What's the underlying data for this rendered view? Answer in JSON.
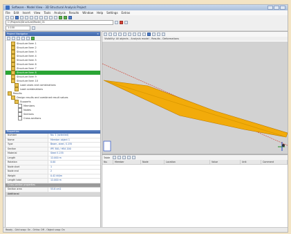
{
  "window": {
    "title": "Software - Model View - 3D Structural Analysis Project"
  },
  "menu": [
    "File",
    "Edit",
    "Insert",
    "View",
    "Tools",
    "Analysis",
    "Results",
    "Window",
    "Help",
    "Settings",
    "Extras"
  ],
  "toolbar": {
    "address": "C:\\Projects\\Structure\\Model_01",
    "filter": "1:100"
  },
  "navigator": {
    "header": "Project Navigator",
    "items": [
      {
        "label": "Structure Item 1",
        "level": 1,
        "selected": false
      },
      {
        "label": "Structure Item 2",
        "level": 1,
        "selected": false
      },
      {
        "label": "Structure Item 3",
        "level": 1,
        "selected": false
      },
      {
        "label": "Structure Item 4",
        "level": 1,
        "selected": false
      },
      {
        "label": "Structure Item 5",
        "level": 1,
        "selected": false
      },
      {
        "label": "Structure Item 6",
        "level": 1,
        "selected": false
      },
      {
        "label": "Structure Item 7",
        "level": 1,
        "selected": false
      },
      {
        "label": "Structure Item 8",
        "level": 1,
        "selected": true
      },
      {
        "label": "Structure Item 9",
        "level": 1,
        "selected": false
      },
      {
        "label": "Structure Item 10",
        "level": 1,
        "selected": false
      },
      {
        "label": "Load cases and combinations",
        "level": 2,
        "selected": false
      },
      {
        "label": "Load combinations",
        "level": 2,
        "selected": false
      },
      {
        "label": "Results",
        "level": 0,
        "selected": false
      },
      {
        "label": "Design results and combined result values",
        "level": 1,
        "selected": false
      },
      {
        "label": "Supports",
        "level": 2,
        "selected": false
      },
      {
        "label": "Members",
        "level": 3,
        "selected": false
      },
      {
        "label": "Nodes",
        "level": 3,
        "selected": false
      },
      {
        "label": "Sections",
        "level": 3,
        "selected": false
      },
      {
        "label": "Cross-sections",
        "level": 3,
        "selected": false
      }
    ]
  },
  "properties": {
    "header": "Properties",
    "rows": [
      {
        "key": "Number",
        "value": "No. 1 (selected)"
      },
      {
        "key": "Name",
        "value": "Member object 1"
      },
      {
        "key": "Type",
        "value": "Beam, steel, S 235"
      },
      {
        "key": "Section",
        "value": "IPE 300 / HEA 200"
      },
      {
        "key": "Material",
        "value": "Steel S 235"
      },
      {
        "key": "Length",
        "value": "12.000 m"
      },
      {
        "key": "Rotation",
        "value": "0.00"
      },
      {
        "key": "Node start",
        "value": "1"
      },
      {
        "key": "Node end",
        "value": "2"
      },
      {
        "key": "Weight",
        "value": "0.42 kN/m"
      },
      {
        "key": "Length total",
        "value": "12.000 m"
      }
    ],
    "category1": "Cross-section properties",
    "cat1rows": [
      {
        "key": "Section area",
        "value": "53.8 cm2"
      }
    ],
    "category2": "Additional"
  },
  "view": {
    "status": "Visibility: All objects - Analysis model - Results - Deformations",
    "colors": {
      "beam": "#f2ab0a",
      "beam_edge": "#b87800",
      "axis_line": "#d44a3a",
      "background": "#d2d2d2"
    }
  },
  "table": {
    "header": "Table",
    "columns": [
      "No.",
      "Member",
      "Node",
      "Location",
      "Value",
      "Unit",
      "Comment"
    ]
  },
  "statusbar": "Ready - Grid snap: On - Ortho: Off - Object snap: On"
}
